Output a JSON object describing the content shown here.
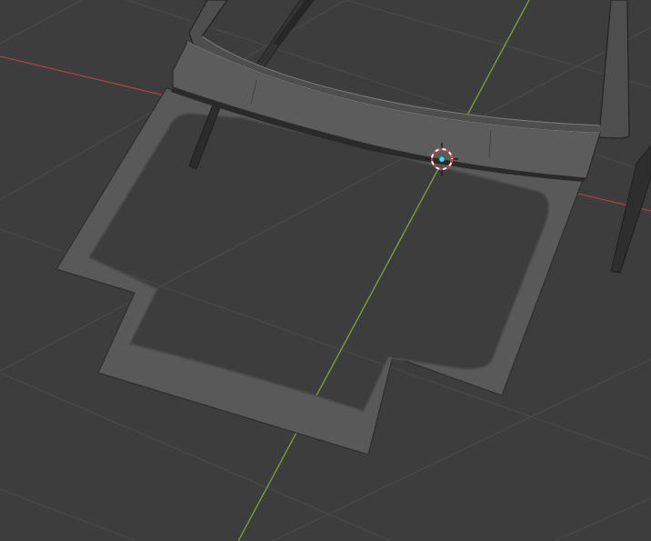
{
  "viewport": {
    "background": "#3d3d3d",
    "grid_color": "#4a4a4a",
    "x_axis_color": "#a8434a",
    "y_axis_color": "#7fa33a"
  },
  "scene": {
    "objects": [
      "floor-plate",
      "windshield-frame",
      "pillar-left",
      "pillar-right"
    ],
    "plate_color": "#585858",
    "frame_color": "#5c5c5c",
    "frame_dark": "#2a2a2a"
  },
  "cursor_3d": {
    "icon": "3d-cursor-icon",
    "ring_color_a": "#d8303a",
    "ring_color_b": "#ffffff",
    "center_color": "#4fd6e8"
  }
}
